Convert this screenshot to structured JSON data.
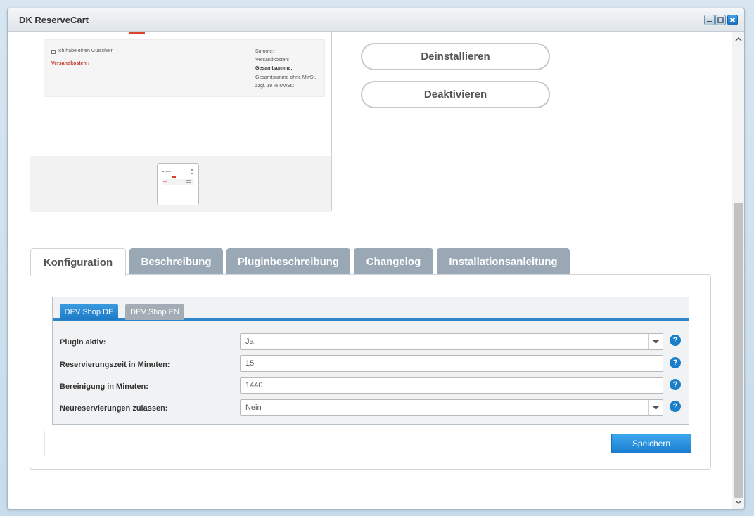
{
  "window": {
    "title": "DK ReserveCart"
  },
  "preview": {
    "voucher_text": "Ich habe einen Gutschein",
    "shipping_link": "Versandkosten ›",
    "summary": {
      "sum": "Summe:",
      "shipping": "Versandkosten:",
      "total": "Gesamtsumme:",
      "net": "Gesamtsumme ohne MwSt.:",
      "vat": "zzgl. 19 % MwSt.:"
    }
  },
  "actions": {
    "uninstall": "Deinstallieren",
    "deactivate": "Deaktivieren"
  },
  "tabs": [
    {
      "label": "Konfiguration",
      "active": true
    },
    {
      "label": "Beschreibung",
      "active": false
    },
    {
      "label": "Pluginbeschreibung",
      "active": false
    },
    {
      "label": "Changelog",
      "active": false
    },
    {
      "label": "Installationsanleitung",
      "active": false
    }
  ],
  "shop_tabs": [
    {
      "label": "DEV Shop DE",
      "active": true
    },
    {
      "label": "DEV Shop EN",
      "active": false
    }
  ],
  "settings": [
    {
      "label": "Plugin aktiv:",
      "value": "Ja",
      "type": "select"
    },
    {
      "label": "Reservierungszeit in Minuten:",
      "value": "15",
      "type": "input"
    },
    {
      "label": "Bereinigung in Minuten:",
      "value": "1440",
      "type": "input"
    },
    {
      "label": "Neureservierungen zulassen:",
      "value": "Nein",
      "type": "select"
    }
  ],
  "help_glyph": "?",
  "save_label": "Speichern",
  "colors": {
    "accent": "#1f7bc6",
    "tab_inactive": "#9aa8b5",
    "link_red": "#c0392b"
  },
  "icons": [
    "minimize-icon",
    "maximize-icon",
    "close-icon",
    "help-icon",
    "chevron-down-icon",
    "scroll-up-icon",
    "scroll-down-icon"
  ]
}
